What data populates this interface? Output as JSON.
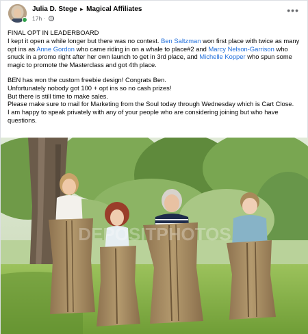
{
  "post": {
    "author": "Julia D. Stege",
    "separator": "▸",
    "group": "Magical Affiliates",
    "time": "17h",
    "more_label": "•••",
    "p1_line1": "FINAL OPT IN LEADERBOARD",
    "p1_a": "I kept it open a while longer but there was no contest. ",
    "mention1": "Ben Saltzman",
    "p1_b": " won first place with twice as many opt ins as ",
    "mention2": "Anne Gordon",
    "p1_c": " who came riding in on a whale to place#2 and ",
    "mention3": "Marcy Nelson-Garrison",
    "p1_d": " who snuck in a promo right after her own launch to get in 3rd place, and ",
    "mention4": "Michelle Kopper",
    "p1_e": " who spun some magic to promote the Masterclass and got 4th place.",
    "p2_line1": "BEN has won the custom freebie design! Congrats Ben.",
    "p2_line2": "Unfortunately nobody got 100 + opt ins so no cash prizes!",
    "p2_line3": "But there is still time to make sales.",
    "p2_line4": "Please make sure to mail for Marketing from the Soul today through Wednesday which is Cart Close.",
    "p2_line5": "I am happy to speak privately with any of your people who are considering joining but who have questions."
  },
  "photo": {
    "watermark": "DEPOSITPHOTOS"
  },
  "colors": {
    "link": "#216fdb",
    "secondary_text": "#65676b",
    "online": "#31a24c",
    "grass": "#86b24a",
    "sack": "#a98d62"
  }
}
